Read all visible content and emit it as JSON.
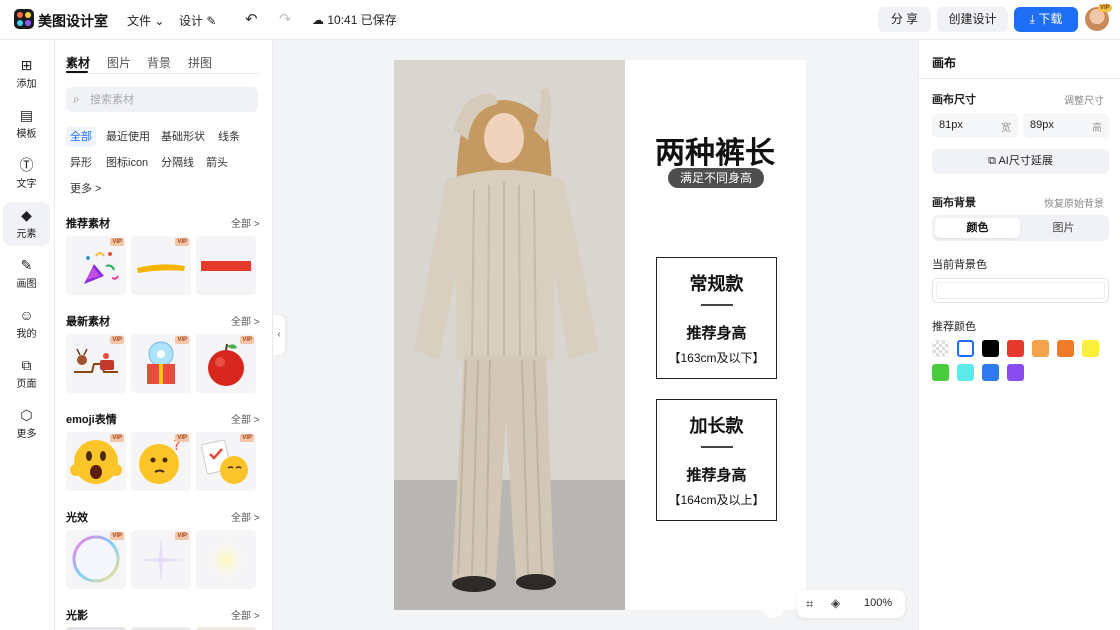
{
  "app": {
    "name": "美图设计室"
  },
  "menu": {
    "file": "文件",
    "design": "设计",
    "save_status": "10:41 已保存"
  },
  "topbar": {
    "share": "分 享",
    "create": "创建设计",
    "download": "下载",
    "vip": "VIP"
  },
  "leftnav": [
    {
      "label": "添加",
      "icon": "plus-square-icon"
    },
    {
      "label": "模板",
      "icon": "template-icon"
    },
    {
      "label": "文字",
      "icon": "text-icon"
    },
    {
      "label": "元素",
      "icon": "shapes-icon"
    },
    {
      "label": "画图",
      "icon": "draw-icon"
    },
    {
      "label": "我的",
      "icon": "user-icon"
    },
    {
      "label": "页面",
      "icon": "page-add-icon"
    },
    {
      "label": "更多",
      "icon": "cube-icon"
    }
  ],
  "panel": {
    "tabs": [
      "素材",
      "图片",
      "背景",
      "拼图"
    ],
    "search_placeholder": "搜索素材",
    "chips": [
      "全部",
      "最近使用",
      "基础形状",
      "线条",
      "异形",
      "图标icon",
      "分隔线",
      "箭头",
      "更多 >"
    ],
    "all_label": "全部 >",
    "vip": "VIP",
    "sections": [
      {
        "title": "推荐素材"
      },
      {
        "title": "最新素材"
      },
      {
        "title": "emoji表情"
      },
      {
        "title": "光效"
      },
      {
        "title": "光影"
      }
    ]
  },
  "canvas": {
    "title": "两种裤长",
    "subtitle": "满足不同身高",
    "boxes": [
      {
        "name": "常规款",
        "rec": "推荐身高",
        "range": "【163cm及以下】"
      },
      {
        "name": "加长款",
        "rec": "推荐身高",
        "range": "【164cm及以上】"
      }
    ],
    "zoom": "100%"
  },
  "rightpanel": {
    "title": "画布",
    "size_label": "画布尺寸",
    "resize_link": "调整尺寸",
    "width_value": "81px",
    "width_unit": "宽",
    "height_value": "89px",
    "height_unit": "高",
    "ai_button": "AI尺寸延展",
    "bg_label": "画布背景",
    "restore_link": "恢复原始背景",
    "seg_color": "颜色",
    "seg_image": "图片",
    "current_bg_label": "当前背景色",
    "recommend_label": "推荐颜色",
    "swatches": [
      "transparent",
      "#ffffff",
      "#000000",
      "#e63a2e",
      "#f2a24a",
      "#ef7a2c",
      "#f7ef3c",
      "#4bcc3f",
      "#5de8ea",
      "#2e7bef",
      "#8a4bef"
    ]
  }
}
